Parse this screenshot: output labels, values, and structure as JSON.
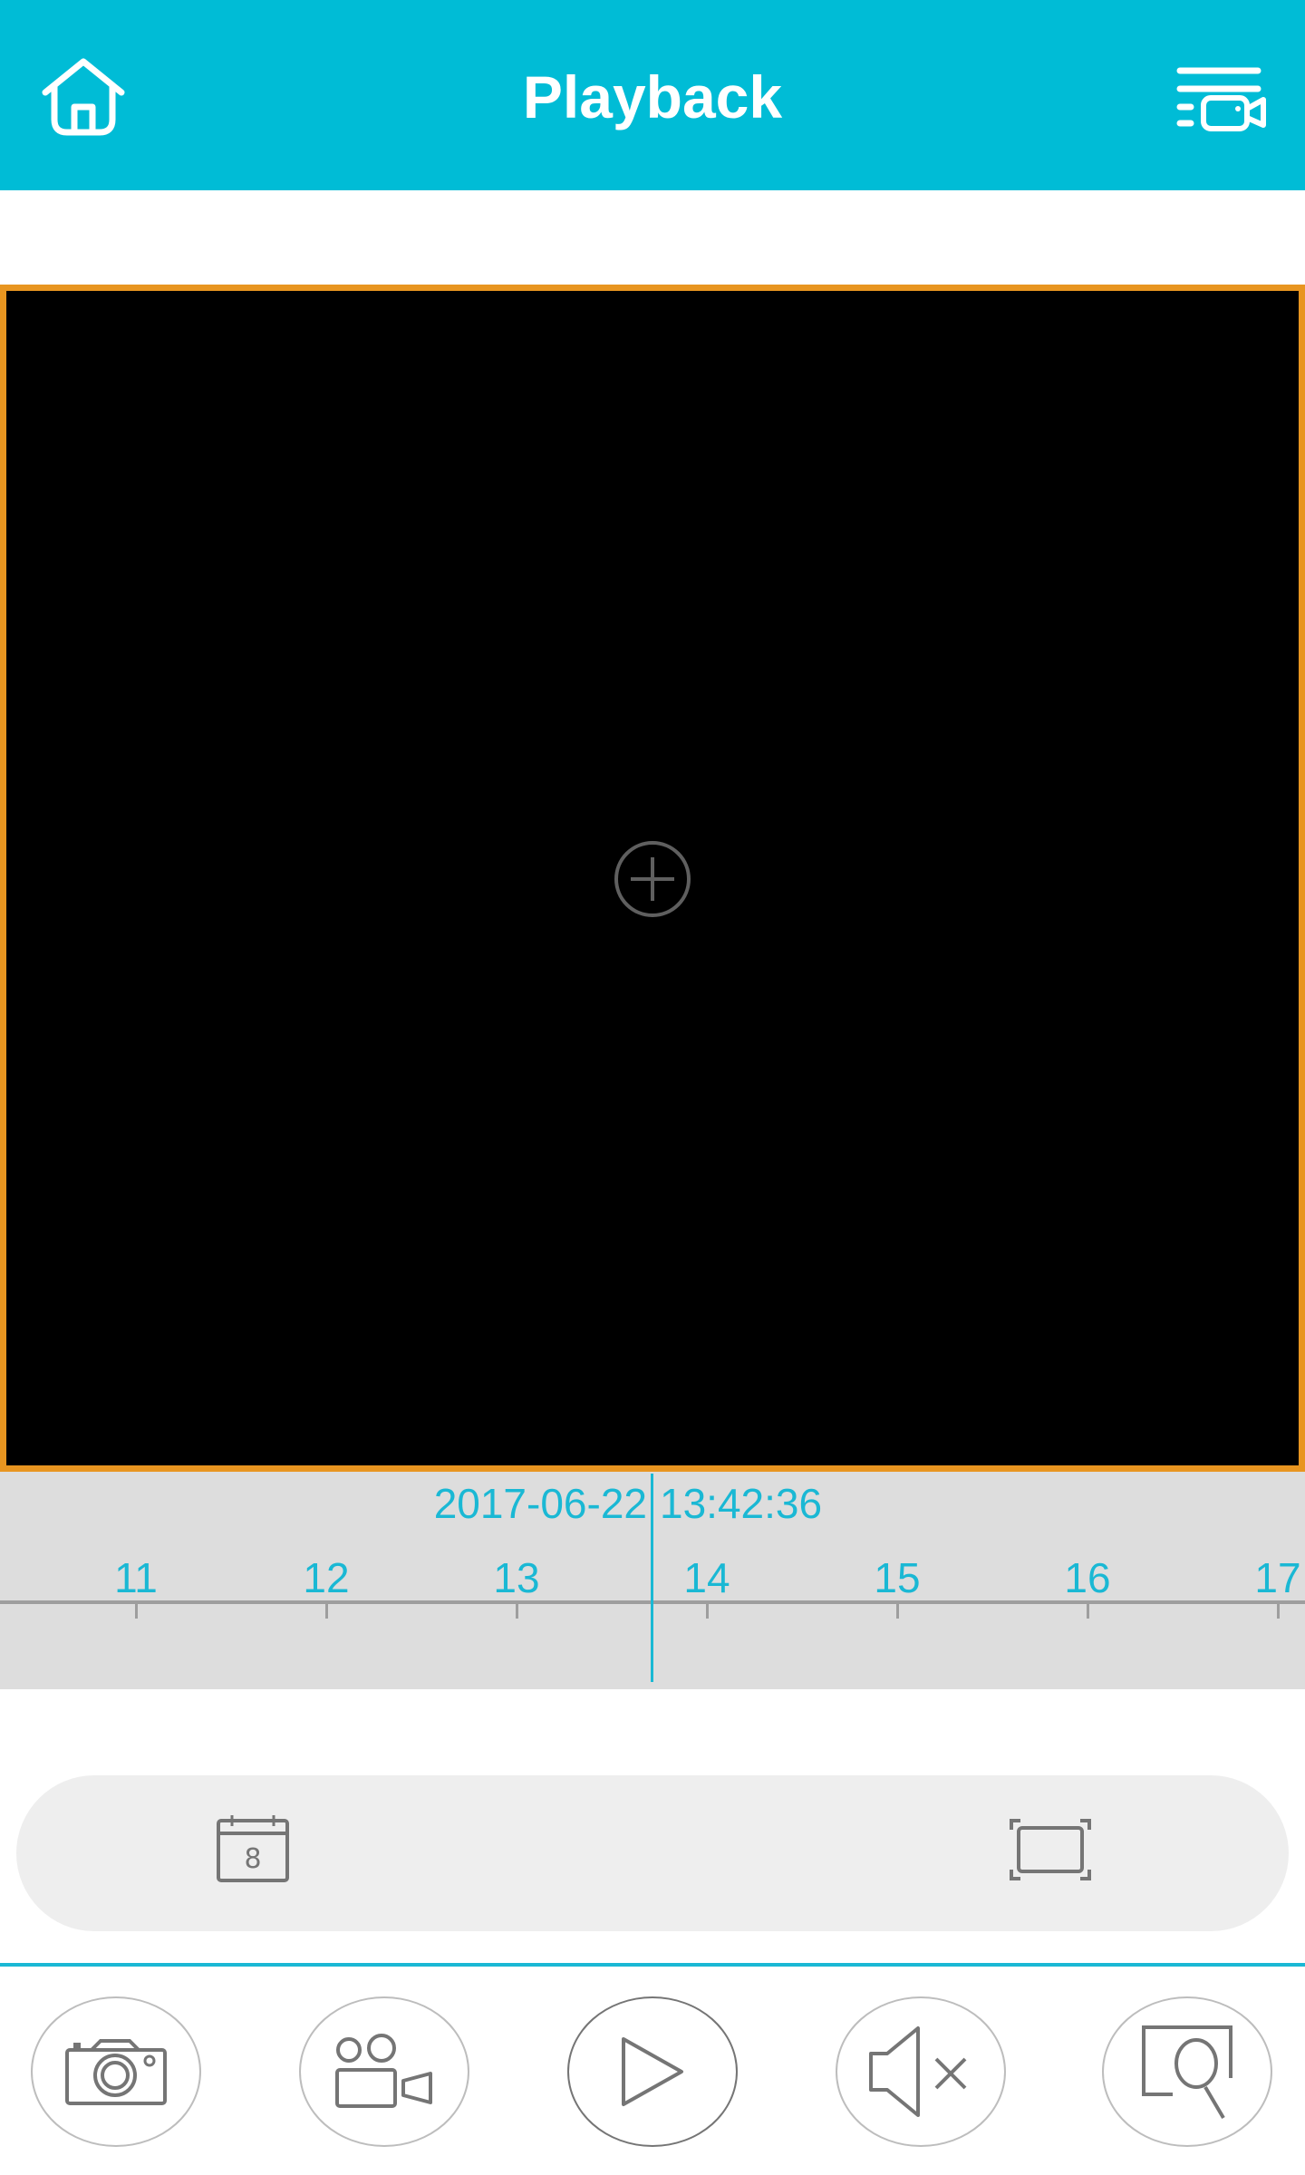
{
  "header": {
    "title": "Playback",
    "left_icon": "home-icon",
    "right_icon": "playback-list-camera-icon"
  },
  "video": {
    "center_icon": "add-channel-icon",
    "border_color": "#e89520"
  },
  "timeline": {
    "date": "2017-06-22",
    "time": "13:42:36",
    "hours": [
      "11",
      "12",
      "13",
      "14",
      "15",
      "16",
      "17"
    ],
    "accent_color": "#1ab8d4"
  },
  "toolbar": {
    "calendar_icon": "calendar-icon",
    "calendar_day": "8",
    "fullscreen_icon": "fullscreen-icon"
  },
  "controls": [
    {
      "name": "snapshot",
      "icon": "camera-icon"
    },
    {
      "name": "record",
      "icon": "video-record-icon"
    },
    {
      "name": "play",
      "icon": "play-icon"
    },
    {
      "name": "mute",
      "icon": "speaker-muted-icon"
    },
    {
      "name": "search",
      "icon": "zoom-search-icon"
    }
  ],
  "colors": {
    "header_bg": "#00bcd6",
    "timeline_bg": "#dddddd",
    "icon_gray": "#757575"
  }
}
